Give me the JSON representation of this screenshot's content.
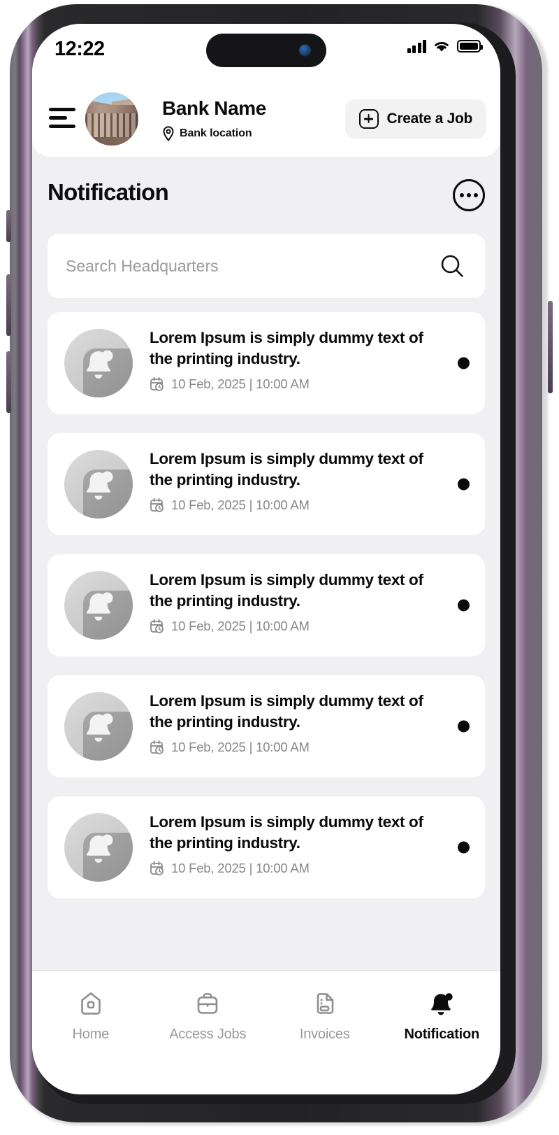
{
  "status_bar": {
    "time": "12:22",
    "signal_icon": "signal-bars-icon",
    "wifi_icon": "wifi-icon",
    "battery_icon": "battery-full-icon"
  },
  "header": {
    "menu_icon": "hamburger-menu-icon",
    "avatar_icon": "bank-building-avatar",
    "bank_name": "Bank Name",
    "location_icon": "location-pin-icon",
    "location_label": "Bank location",
    "create_job": {
      "label": "Create a Job",
      "icon": "plus-square-icon"
    }
  },
  "page": {
    "title": "Notification",
    "more_icon": "more-options-icon"
  },
  "search": {
    "placeholder": "Search Headquarters",
    "value": "",
    "icon": "search-icon"
  },
  "notifications": [
    {
      "avatar_icon": "bell-avatar-icon",
      "text": "Lorem Ipsum is simply dummy text of the printing industry.",
      "date_icon": "calendar-clock-icon",
      "meta": "10 Feb, 2025  |  10:00 AM",
      "unread": true
    },
    {
      "avatar_icon": "bell-avatar-icon",
      "text": "Lorem Ipsum is simply dummy text of the printing industry.",
      "date_icon": "calendar-clock-icon",
      "meta": "10 Feb, 2025  |  10:00 AM",
      "unread": true
    },
    {
      "avatar_icon": "bell-avatar-icon",
      "text": "Lorem Ipsum is simply dummy text of the printing industry.",
      "date_icon": "calendar-clock-icon",
      "meta": "10 Feb, 2025  |  10:00 AM",
      "unread": true
    },
    {
      "avatar_icon": "bell-avatar-icon",
      "text": "Lorem Ipsum is simply dummy text of the printing industry.",
      "date_icon": "calendar-clock-icon",
      "meta": "10 Feb, 2025  |  10:00 AM",
      "unread": true
    },
    {
      "avatar_icon": "bell-avatar-icon",
      "text": "Lorem Ipsum is simply dummy text of the printing industry.",
      "date_icon": "calendar-clock-icon",
      "meta": "10 Feb, 2025  |  10:00 AM",
      "unread": true
    }
  ],
  "bottom_nav": {
    "items": [
      {
        "label": "Home",
        "icon": "home-icon",
        "active": false
      },
      {
        "label": "Access Jobs",
        "icon": "briefcase-icon",
        "active": false
      },
      {
        "label": "Invoices",
        "icon": "document-icon",
        "active": false
      },
      {
        "label": "Notification",
        "icon": "bell-filled-icon",
        "active": true
      }
    ]
  },
  "colors": {
    "screen_bg": "#f0f0f2",
    "card_bg": "#ffffff",
    "text_primary": "#0b0b0b",
    "text_muted": "#87878c",
    "nav_inactive": "#9a9a9f",
    "unread_dot": "#0b0b0b",
    "frame": "#5d4a5e"
  }
}
